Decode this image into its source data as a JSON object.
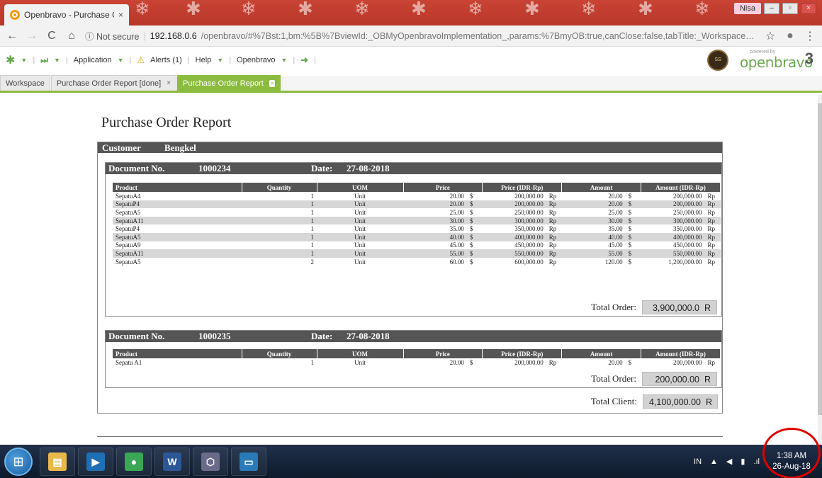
{
  "browser": {
    "tab_title": "Openbravo - Purchase O",
    "tab_close": "×",
    "user_badge": "Nisa",
    "win_min": "–",
    "win_max": "▫",
    "win_close": "×",
    "security": "ⓘ Not secure",
    "host": "192.168.0.6",
    "path": "/openbravo/#%7Bst:1,bm:%5B%7BviewId:_OBMyOpenbravoImplementation_,params:%7BmyOB:true,canClose:false,tabTitle:_Workspace_%7D%7D,%7B...",
    "back": "←",
    "forward": "→",
    "reload": "C",
    "home": "⌂",
    "star": "☆",
    "menu": "⋮"
  },
  "toolbar": {
    "application": "Application",
    "alerts": "Alerts (1)",
    "help": "Help",
    "user_menu": "Openbravo",
    "powered_by": "powered by",
    "brand": "openbravo",
    "brand_version": "3",
    "client_logo_text": "SS"
  },
  "app_tabs": [
    {
      "label": "Workspace",
      "closable": false
    },
    {
      "label": "Purchase Order Report [done]",
      "closable": true
    },
    {
      "label": "Purchase Order Report",
      "closable": true,
      "active": true
    }
  ],
  "report": {
    "title": "Purchase Order Report",
    "customer_label": "Customer",
    "customer_name": "Bengkel",
    "doc_label": "Document No.",
    "date_label": "Date:",
    "total_order_label": "Total Order:",
    "total_client_label": "Total Client:",
    "total_client_value": "4,100,000.00",
    "total_client_cur": "R",
    "columns": [
      "Product",
      "Quantity",
      "UOM",
      "Price",
      "Price (IDR-Rp)",
      "Amount",
      "Amount (IDR-Rp)"
    ],
    "documents": [
      {
        "doc_no": "1000234",
        "date": "27-08-2018",
        "total_order": "3,900,000.0",
        "total_order_cur": "R",
        "lines": [
          {
            "product": "SepatuA4",
            "qty": "1",
            "uom": "Unit",
            "price": "20.00",
            "price_cur": "$",
            "price_idr": "200,000.00",
            "price_idr_cur": "Rp",
            "amount": "20.00",
            "amount_cur": "$",
            "amount_idr": "200,000.00",
            "amount_idr_cur": "Rp"
          },
          {
            "product": "SepatuP4",
            "qty": "1",
            "uom": "Unit",
            "price": "20.00",
            "price_cur": "$",
            "price_idr": "200,000.00",
            "price_idr_cur": "Rp",
            "amount": "20.00",
            "amount_cur": "$",
            "amount_idr": "200,000.00",
            "amount_idr_cur": "Rp"
          },
          {
            "product": "SepatuA5",
            "qty": "1",
            "uom": "Unit",
            "price": "25.00",
            "price_cur": "$",
            "price_idr": "250,000.00",
            "price_idr_cur": "Rp",
            "amount": "25.00",
            "amount_cur": "$",
            "amount_idr": "250,000.00",
            "amount_idr_cur": "Rp"
          },
          {
            "product": "SepatuA11",
            "qty": "1",
            "uom": "Unit",
            "price": "30.00",
            "price_cur": "$",
            "price_idr": "300,000.00",
            "price_idr_cur": "Rp",
            "amount": "30.00",
            "amount_cur": "$",
            "amount_idr": "300,000.00",
            "amount_idr_cur": "Rp"
          },
          {
            "product": "SepatuP4",
            "qty": "1",
            "uom": "Unit",
            "price": "35.00",
            "price_cur": "$",
            "price_idr": "350,000.00",
            "price_idr_cur": "Rp",
            "amount": "35.00",
            "amount_cur": "$",
            "amount_idr": "350,000.00",
            "amount_idr_cur": "Rp"
          },
          {
            "product": "SepatuA5",
            "qty": "1",
            "uom": "Unit",
            "price": "40.00",
            "price_cur": "$",
            "price_idr": "400,000.00",
            "price_idr_cur": "Rp",
            "amount": "40.00",
            "amount_cur": "$",
            "amount_idr": "400,000.00",
            "amount_idr_cur": "Rp"
          },
          {
            "product": "SepatuA9",
            "qty": "1",
            "uom": "Unit",
            "price": "45.00",
            "price_cur": "$",
            "price_idr": "450,000.00",
            "price_idr_cur": "Rp",
            "amount": "45.00",
            "amount_cur": "$",
            "amount_idr": "450,000.00",
            "amount_idr_cur": "Rp"
          },
          {
            "product": "SepatuA11",
            "qty": "1",
            "uom": "Unit",
            "price": "55.00",
            "price_cur": "$",
            "price_idr": "550,000.00",
            "price_idr_cur": "Rp",
            "amount": "55.00",
            "amount_cur": "$",
            "amount_idr": "550,000.00",
            "amount_idr_cur": "Rp"
          },
          {
            "product": "SepatuA5",
            "qty": "2",
            "uom": "Unit",
            "price": "60.00",
            "price_cur": "$",
            "price_idr": "600,000.00",
            "price_idr_cur": "Rp",
            "amount": "120.00",
            "amount_cur": "$",
            "amount_idr": "1,200,000.00",
            "amount_idr_cur": "Rp"
          }
        ]
      },
      {
        "doc_no": "1000235",
        "date": "27-08-2018",
        "total_order": "200,000.00",
        "total_order_cur": "R",
        "lines": [
          {
            "product": "Sepatu A1",
            "qty": "1",
            "uom": "Unit",
            "price": "20.00",
            "price_cur": "$",
            "price_idr": "200,000.00",
            "price_idr_cur": "Rp",
            "amount": "20.00",
            "amount_cur": "$",
            "amount_idr": "200,000.00",
            "amount_idr_cur": "Rp"
          }
        ]
      }
    ]
  },
  "taskbar": {
    "apps": [
      {
        "icon": "file-explorer-icon",
        "glyph": "▤",
        "color": "#e8b84a"
      },
      {
        "icon": "media-player-icon",
        "glyph": "▶",
        "color": "#1f6fb5"
      },
      {
        "icon": "chrome-icon",
        "glyph": "●",
        "color": "#3aa757"
      },
      {
        "icon": "word-icon",
        "glyph": "W",
        "color": "#2b5797"
      },
      {
        "icon": "virtualbox-icon",
        "glyph": "⬡",
        "color": "#6a6a8a"
      },
      {
        "icon": "remote-desktop-icon",
        "glyph": "▭",
        "color": "#2a7ab8"
      }
    ],
    "start_glyph": "⊞",
    "language": "IN",
    "tray_up": "▲",
    "time": "1:38 AM",
    "date": "26-Aug-18"
  }
}
